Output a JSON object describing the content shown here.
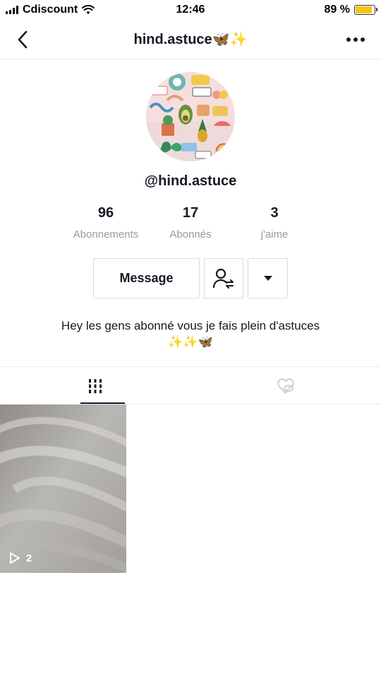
{
  "status_bar": {
    "carrier": "Cdiscount",
    "time": "12:46",
    "battery_percent": "89 %",
    "battery_level": 0.89,
    "battery_color": "#f5c518"
  },
  "nav": {
    "title": "hind.astuce🦋✨",
    "back_icon": "chevron-left-icon",
    "more_icon": "more-horizontal-icon"
  },
  "profile": {
    "handle": "@hind.astuce",
    "stats": [
      {
        "value": "96",
        "label": "Abonnements"
      },
      {
        "value": "17",
        "label": "Abonnés"
      },
      {
        "value": "3",
        "label": "j'aime"
      }
    ],
    "message_button": "Message",
    "bio_line1": "Hey les gens abonné vous je fais plein d'astuces",
    "bio_line2": "✨✨🦋"
  },
  "tabs": [
    {
      "name": "videos",
      "icon": "grid-icon",
      "active": true
    },
    {
      "name": "liked",
      "icon": "liked-hidden-icon",
      "active": false
    }
  ],
  "videos": [
    {
      "play_count": "2"
    }
  ],
  "colors": {
    "text_primary": "#161823",
    "text_secondary": "#9a9aa0",
    "border": "#dcdcdc"
  }
}
